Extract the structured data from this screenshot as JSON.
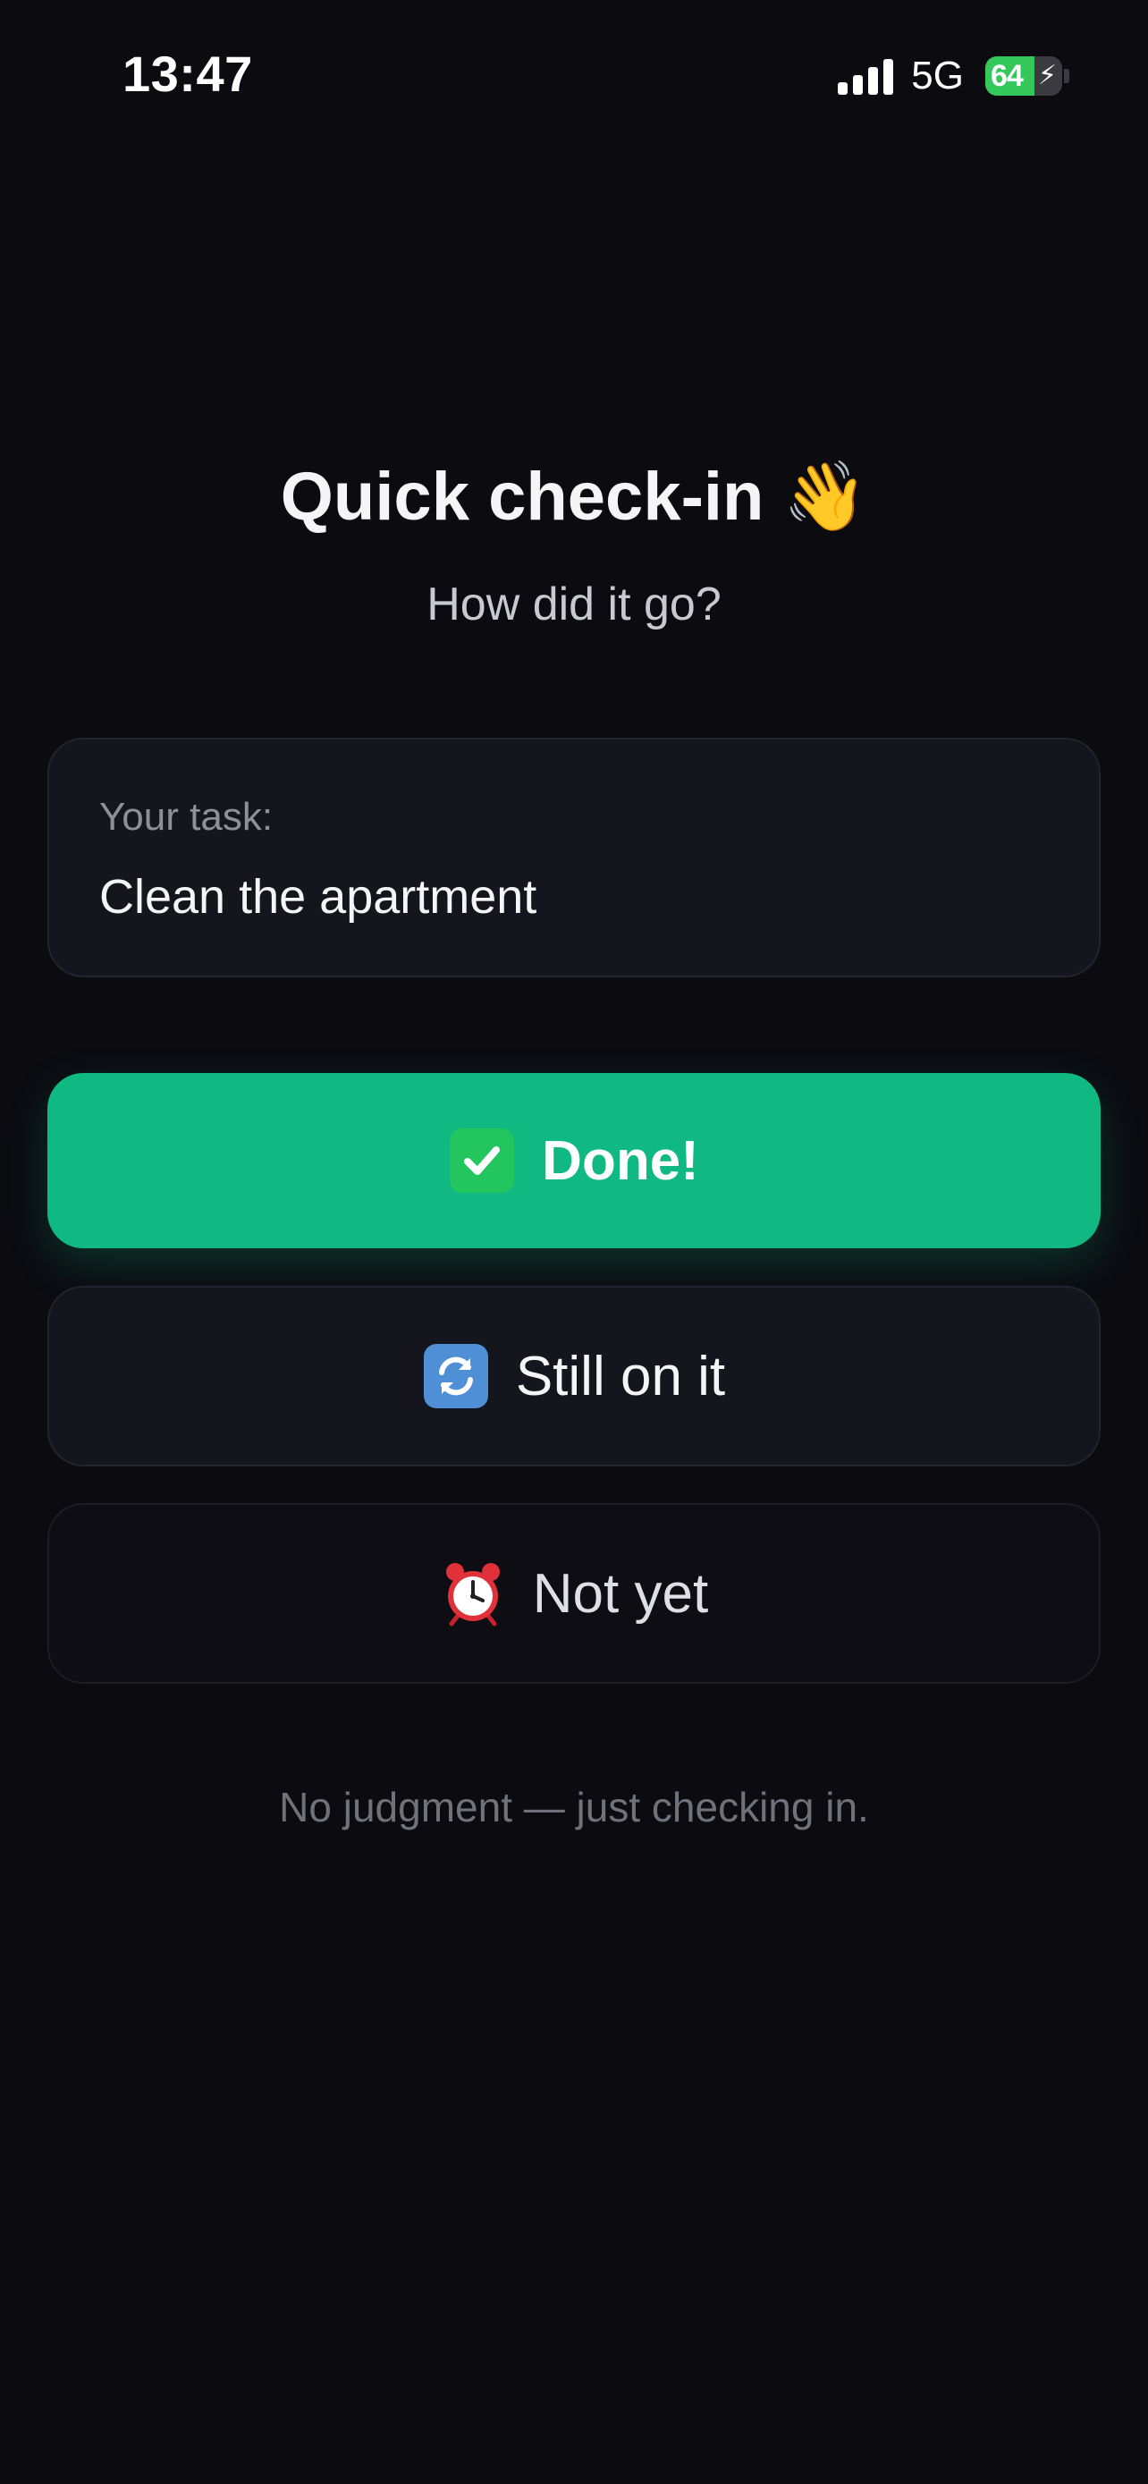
{
  "status_bar": {
    "time": "13:47",
    "network": "5G",
    "battery_level": 64,
    "battery_text": "64",
    "charging": true
  },
  "header": {
    "title": "Quick check-in",
    "title_emoji": "👋",
    "subtitle": "How did it go?"
  },
  "task_card": {
    "label": "Your task:",
    "task_name": "Clean the apartment"
  },
  "options": {
    "done": {
      "label": "Done!",
      "icon": "check-mark-icon",
      "color": "#10b981"
    },
    "still_on_it": {
      "label": "Still on it",
      "icon": "refresh-icon"
    },
    "not_yet": {
      "label": "Not yet",
      "icon": "alarm-clock-icon"
    }
  },
  "footer": {
    "note": "No judgment — just checking in."
  },
  "colors": {
    "background": "#0b0b10",
    "card": "#14151d",
    "accent_green": "#10b981"
  }
}
